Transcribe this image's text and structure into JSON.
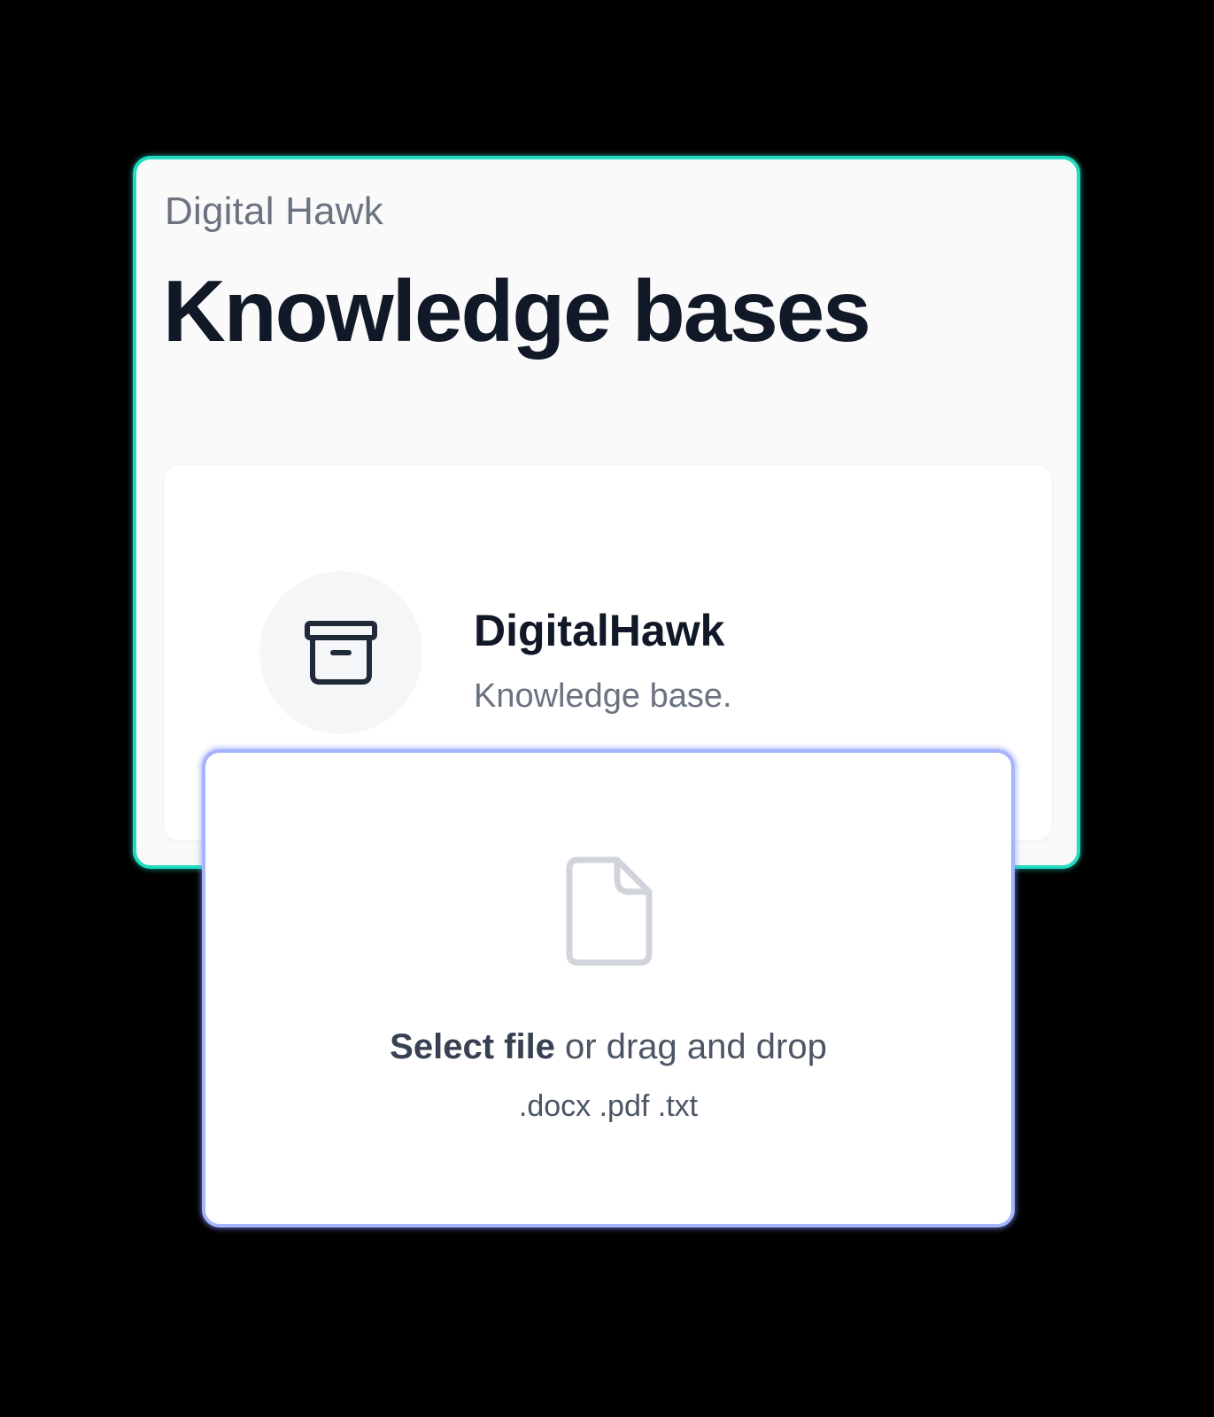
{
  "header": {
    "org_name": "Digital Hawk",
    "title": "Knowledge bases"
  },
  "knowledge_base": {
    "name": "DigitalHawk",
    "description": "Knowledge base.",
    "icon": "archive-box-icon"
  },
  "dropzone": {
    "select_label": "Select file",
    "drag_label": " or drag and drop",
    "file_types": ".docx .pdf .txt",
    "icon": "document-icon"
  },
  "colors": {
    "panel_border": "#20dcc0",
    "dropzone_border": "#a5b4fc",
    "title": "#111827",
    "muted": "#6b7280",
    "background": "#000000"
  }
}
